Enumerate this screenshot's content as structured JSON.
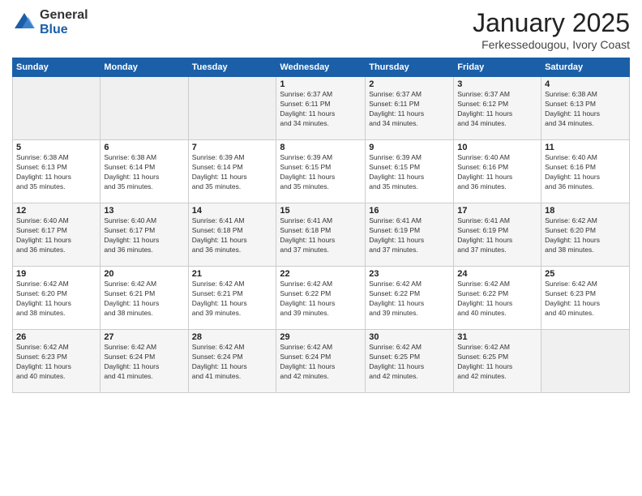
{
  "logo": {
    "general": "General",
    "blue": "Blue"
  },
  "title": {
    "month": "January 2025",
    "location": "Ferkessedougou, Ivory Coast"
  },
  "days_header": [
    "Sunday",
    "Monday",
    "Tuesday",
    "Wednesday",
    "Thursday",
    "Friday",
    "Saturday"
  ],
  "weeks": [
    [
      {
        "num": "",
        "info": ""
      },
      {
        "num": "",
        "info": ""
      },
      {
        "num": "",
        "info": ""
      },
      {
        "num": "1",
        "info": "Sunrise: 6:37 AM\nSunset: 6:11 PM\nDaylight: 11 hours\nand 34 minutes."
      },
      {
        "num": "2",
        "info": "Sunrise: 6:37 AM\nSunset: 6:11 PM\nDaylight: 11 hours\nand 34 minutes."
      },
      {
        "num": "3",
        "info": "Sunrise: 6:37 AM\nSunset: 6:12 PM\nDaylight: 11 hours\nand 34 minutes."
      },
      {
        "num": "4",
        "info": "Sunrise: 6:38 AM\nSunset: 6:13 PM\nDaylight: 11 hours\nand 34 minutes."
      }
    ],
    [
      {
        "num": "5",
        "info": "Sunrise: 6:38 AM\nSunset: 6:13 PM\nDaylight: 11 hours\nand 35 minutes."
      },
      {
        "num": "6",
        "info": "Sunrise: 6:38 AM\nSunset: 6:14 PM\nDaylight: 11 hours\nand 35 minutes."
      },
      {
        "num": "7",
        "info": "Sunrise: 6:39 AM\nSunset: 6:14 PM\nDaylight: 11 hours\nand 35 minutes."
      },
      {
        "num": "8",
        "info": "Sunrise: 6:39 AM\nSunset: 6:15 PM\nDaylight: 11 hours\nand 35 minutes."
      },
      {
        "num": "9",
        "info": "Sunrise: 6:39 AM\nSunset: 6:15 PM\nDaylight: 11 hours\nand 35 minutes."
      },
      {
        "num": "10",
        "info": "Sunrise: 6:40 AM\nSunset: 6:16 PM\nDaylight: 11 hours\nand 36 minutes."
      },
      {
        "num": "11",
        "info": "Sunrise: 6:40 AM\nSunset: 6:16 PM\nDaylight: 11 hours\nand 36 minutes."
      }
    ],
    [
      {
        "num": "12",
        "info": "Sunrise: 6:40 AM\nSunset: 6:17 PM\nDaylight: 11 hours\nand 36 minutes."
      },
      {
        "num": "13",
        "info": "Sunrise: 6:40 AM\nSunset: 6:17 PM\nDaylight: 11 hours\nand 36 minutes."
      },
      {
        "num": "14",
        "info": "Sunrise: 6:41 AM\nSunset: 6:18 PM\nDaylight: 11 hours\nand 36 minutes."
      },
      {
        "num": "15",
        "info": "Sunrise: 6:41 AM\nSunset: 6:18 PM\nDaylight: 11 hours\nand 37 minutes."
      },
      {
        "num": "16",
        "info": "Sunrise: 6:41 AM\nSunset: 6:19 PM\nDaylight: 11 hours\nand 37 minutes."
      },
      {
        "num": "17",
        "info": "Sunrise: 6:41 AM\nSunset: 6:19 PM\nDaylight: 11 hours\nand 37 minutes."
      },
      {
        "num": "18",
        "info": "Sunrise: 6:42 AM\nSunset: 6:20 PM\nDaylight: 11 hours\nand 38 minutes."
      }
    ],
    [
      {
        "num": "19",
        "info": "Sunrise: 6:42 AM\nSunset: 6:20 PM\nDaylight: 11 hours\nand 38 minutes."
      },
      {
        "num": "20",
        "info": "Sunrise: 6:42 AM\nSunset: 6:21 PM\nDaylight: 11 hours\nand 38 minutes."
      },
      {
        "num": "21",
        "info": "Sunrise: 6:42 AM\nSunset: 6:21 PM\nDaylight: 11 hours\nand 39 minutes."
      },
      {
        "num": "22",
        "info": "Sunrise: 6:42 AM\nSunset: 6:22 PM\nDaylight: 11 hours\nand 39 minutes."
      },
      {
        "num": "23",
        "info": "Sunrise: 6:42 AM\nSunset: 6:22 PM\nDaylight: 11 hours\nand 39 minutes."
      },
      {
        "num": "24",
        "info": "Sunrise: 6:42 AM\nSunset: 6:22 PM\nDaylight: 11 hours\nand 40 minutes."
      },
      {
        "num": "25",
        "info": "Sunrise: 6:42 AM\nSunset: 6:23 PM\nDaylight: 11 hours\nand 40 minutes."
      }
    ],
    [
      {
        "num": "26",
        "info": "Sunrise: 6:42 AM\nSunset: 6:23 PM\nDaylight: 11 hours\nand 40 minutes."
      },
      {
        "num": "27",
        "info": "Sunrise: 6:42 AM\nSunset: 6:24 PM\nDaylight: 11 hours\nand 41 minutes."
      },
      {
        "num": "28",
        "info": "Sunrise: 6:42 AM\nSunset: 6:24 PM\nDaylight: 11 hours\nand 41 minutes."
      },
      {
        "num": "29",
        "info": "Sunrise: 6:42 AM\nSunset: 6:24 PM\nDaylight: 11 hours\nand 42 minutes."
      },
      {
        "num": "30",
        "info": "Sunrise: 6:42 AM\nSunset: 6:25 PM\nDaylight: 11 hours\nand 42 minutes."
      },
      {
        "num": "31",
        "info": "Sunrise: 6:42 AM\nSunset: 6:25 PM\nDaylight: 11 hours\nand 42 minutes."
      },
      {
        "num": "",
        "info": ""
      }
    ]
  ]
}
